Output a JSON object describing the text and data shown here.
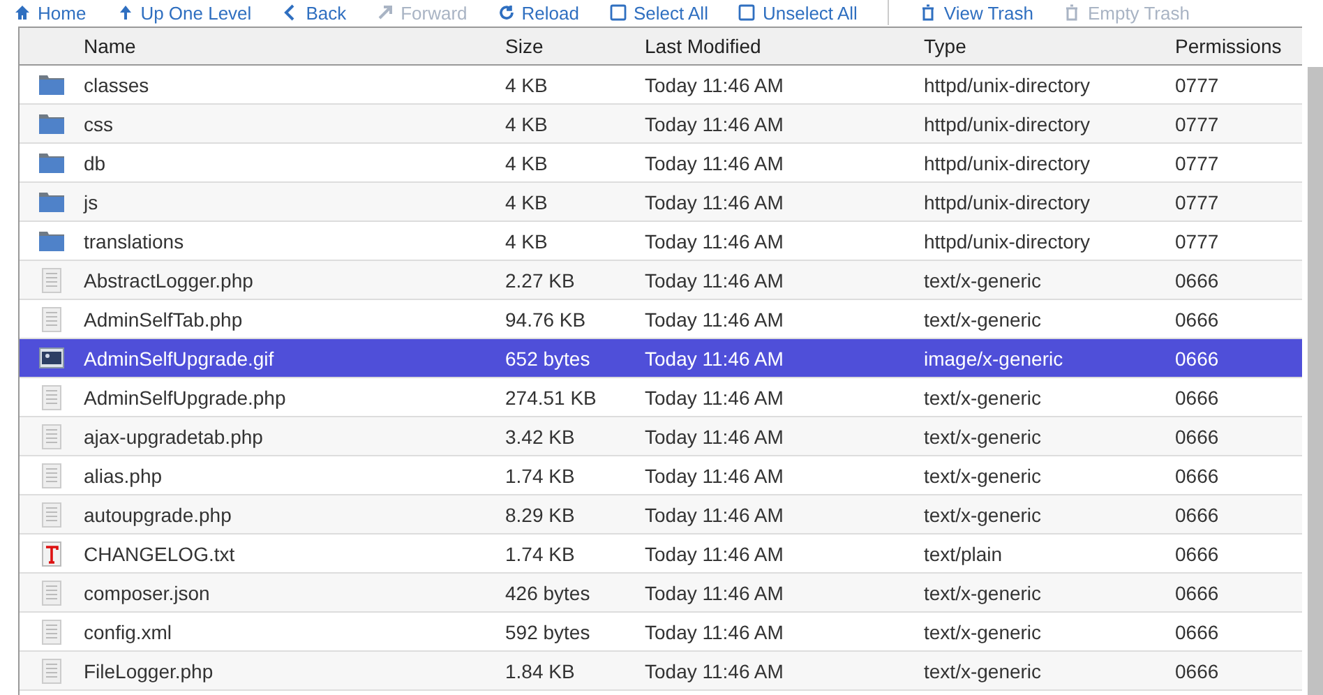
{
  "toolbar": [
    {
      "label": "Home",
      "kind": "home",
      "disabled": false
    },
    {
      "label": "Up One Level",
      "kind": "up",
      "disabled": false
    },
    {
      "label": "Back",
      "kind": "back",
      "disabled": false
    },
    {
      "label": "Forward",
      "kind": "forward",
      "disabled": true
    },
    {
      "label": "Reload",
      "kind": "reload",
      "disabled": false
    },
    {
      "label": "Select All",
      "kind": "check",
      "disabled": false
    },
    {
      "label": "Unselect All",
      "kind": "check",
      "disabled": false
    },
    {
      "label": "View Trash",
      "kind": "trash",
      "disabled": false,
      "divider": true
    },
    {
      "label": "Empty Trash",
      "kind": "trash",
      "disabled": true
    }
  ],
  "table": {
    "columns": [
      "Name",
      "Size",
      "Last Modified",
      "Type",
      "Permissions"
    ],
    "rows": [
      {
        "kind": "folder",
        "name": "classes",
        "size": "4 KB",
        "modified": "Today 11:46 AM",
        "type": "httpd/unix-directory",
        "permissions": "0777",
        "selected": false
      },
      {
        "kind": "folder",
        "name": "css",
        "size": "4 KB",
        "modified": "Today 11:46 AM",
        "type": "httpd/unix-directory",
        "permissions": "0777",
        "selected": false
      },
      {
        "kind": "folder",
        "name": "db",
        "size": "4 KB",
        "modified": "Today 11:46 AM",
        "type": "httpd/unix-directory",
        "permissions": "0777",
        "selected": false
      },
      {
        "kind": "folder",
        "name": "js",
        "size": "4 KB",
        "modified": "Today 11:46 AM",
        "type": "httpd/unix-directory",
        "permissions": "0777",
        "selected": false
      },
      {
        "kind": "folder",
        "name": "translations",
        "size": "4 KB",
        "modified": "Today 11:46 AM",
        "type": "httpd/unix-directory",
        "permissions": "0777",
        "selected": false
      },
      {
        "kind": "file",
        "name": "AbstractLogger.php",
        "size": "2.27 KB",
        "modified": "Today 11:46 AM",
        "type": "text/x-generic",
        "permissions": "0666",
        "selected": false
      },
      {
        "kind": "file",
        "name": "AdminSelfTab.php",
        "size": "94.76 KB",
        "modified": "Today 11:46 AM",
        "type": "text/x-generic",
        "permissions": "0666",
        "selected": false
      },
      {
        "kind": "image",
        "name": "AdminSelfUpgrade.gif",
        "size": "652 bytes",
        "modified": "Today 11:46 AM",
        "type": "image/x-generic",
        "permissions": "0666",
        "selected": true
      },
      {
        "kind": "file",
        "name": "AdminSelfUpgrade.php",
        "size": "274.51 KB",
        "modified": "Today 11:46 AM",
        "type": "text/x-generic",
        "permissions": "0666",
        "selected": false
      },
      {
        "kind": "file",
        "name": "ajax-upgradetab.php",
        "size": "3.42 KB",
        "modified": "Today 11:46 AM",
        "type": "text/x-generic",
        "permissions": "0666",
        "selected": false
      },
      {
        "kind": "file",
        "name": "alias.php",
        "size": "1.74 KB",
        "modified": "Today 11:46 AM",
        "type": "text/x-generic",
        "permissions": "0666",
        "selected": false
      },
      {
        "kind": "file",
        "name": "autoupgrade.php",
        "size": "8.29 KB",
        "modified": "Today 11:46 AM",
        "type": "text/x-generic",
        "permissions": "0666",
        "selected": false
      },
      {
        "kind": "text",
        "name": "CHANGELOG.txt",
        "size": "1.74 KB",
        "modified": "Today 11:46 AM",
        "type": "text/plain",
        "permissions": "0666",
        "selected": false
      },
      {
        "kind": "file",
        "name": "composer.json",
        "size": "426 bytes",
        "modified": "Today 11:46 AM",
        "type": "text/x-generic",
        "permissions": "0666",
        "selected": false
      },
      {
        "kind": "file",
        "name": "config.xml",
        "size": "592 bytes",
        "modified": "Today 11:46 AM",
        "type": "text/x-generic",
        "permissions": "0666",
        "selected": false
      },
      {
        "kind": "file",
        "name": "FileLogger.php",
        "size": "1.84 KB",
        "modified": "Today 11:46 AM",
        "type": "text/x-generic",
        "permissions": "0666",
        "selected": false
      }
    ]
  }
}
